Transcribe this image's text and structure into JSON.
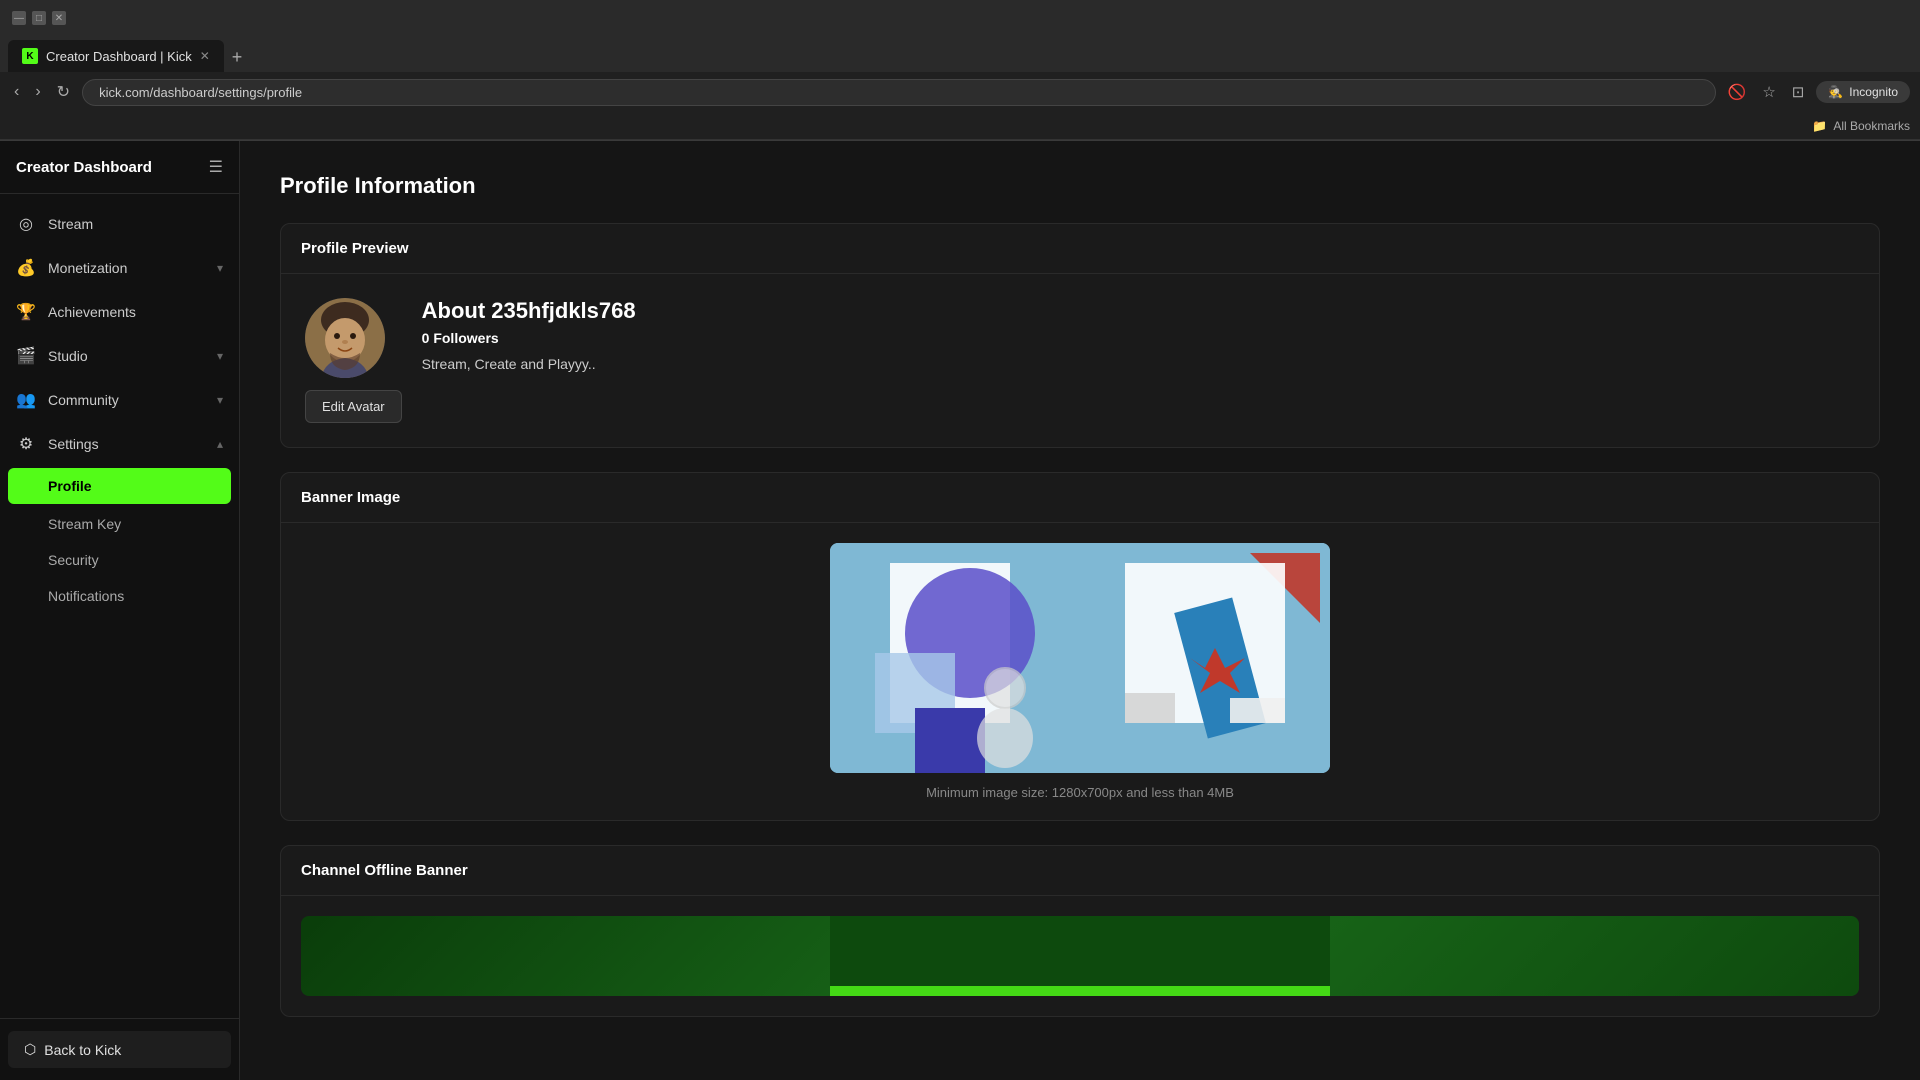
{
  "browser": {
    "tab_title": "Creator Dashboard | Kick",
    "tab_favicon": "K",
    "url": "kick.com/dashboard/settings/profile",
    "incognito_label": "Incognito",
    "bookmarks_label": "All Bookmarks",
    "new_tab_symbol": "+"
  },
  "sidebar": {
    "title": "Creator Dashboard",
    "nav_items": [
      {
        "id": "stream",
        "label": "Stream",
        "icon": "◎",
        "has_chevron": false
      },
      {
        "id": "monetization",
        "label": "Monetization",
        "icon": "💰",
        "has_chevron": true
      },
      {
        "id": "achievements",
        "label": "Achievements",
        "icon": "🏆",
        "has_chevron": false
      },
      {
        "id": "studio",
        "label": "Studio",
        "icon": "🎬",
        "has_chevron": true
      },
      {
        "id": "community",
        "label": "Community",
        "icon": "👥",
        "has_chevron": true
      },
      {
        "id": "settings",
        "label": "Settings",
        "icon": "⚙",
        "has_chevron": true,
        "expanded": true
      }
    ],
    "settings_sub_items": [
      {
        "id": "profile",
        "label": "Profile",
        "active": true
      },
      {
        "id": "stream-key",
        "label": "Stream Key",
        "active": false
      },
      {
        "id": "security",
        "label": "Security",
        "active": false
      },
      {
        "id": "notifications",
        "label": "Notifications",
        "active": false
      }
    ],
    "back_to_kick_label": "Back to Kick",
    "back_icon": "⬡"
  },
  "main": {
    "page_title": "Profile Information",
    "profile_preview": {
      "section_title": "Profile Preview",
      "username": "235hfjdkls768",
      "about_prefix": "About ",
      "followers_count": "0",
      "followers_label": "Followers",
      "bio": "Stream, Create and Playyy..",
      "edit_avatar_label": "Edit Avatar"
    },
    "banner_image": {
      "section_title": "Banner Image",
      "hint": "Minimum image size: 1280x700px and less than 4MB"
    },
    "offline_banner": {
      "section_title": "Channel Offline Banner"
    }
  }
}
